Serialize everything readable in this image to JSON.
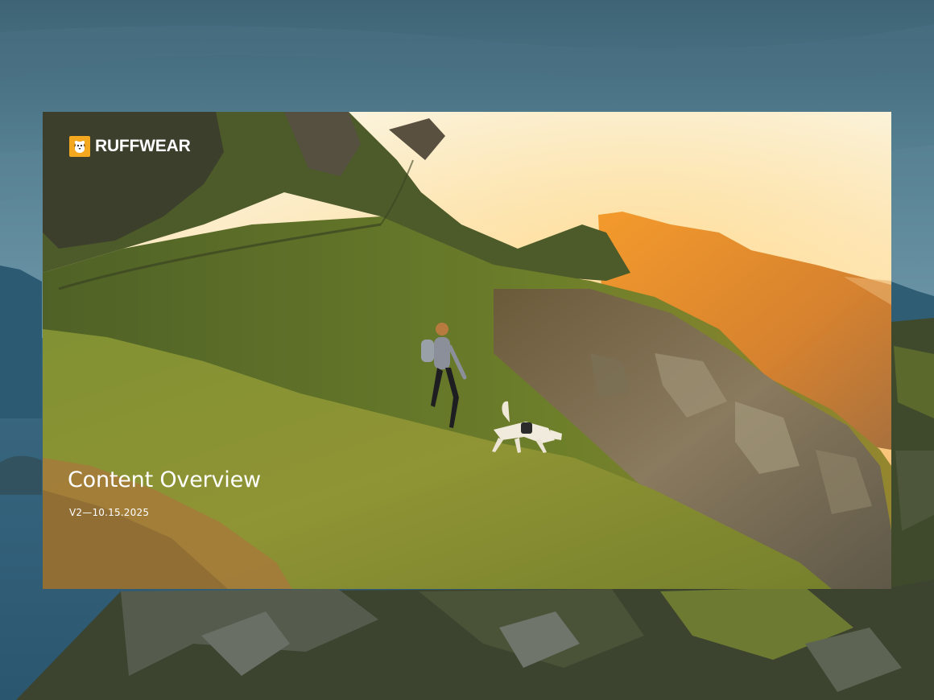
{
  "brand": {
    "name": "RUFFWEAR",
    "logo_icon": "dog-face-icon",
    "logo_color": "#f3a81f"
  },
  "hero": {
    "title": "Content Overview",
    "version": "V2—10.15.2025"
  },
  "colors": {
    "text": "#ffffff",
    "sunset_glow": "#f6a73a",
    "hillside_green": "#7f8f2c"
  }
}
